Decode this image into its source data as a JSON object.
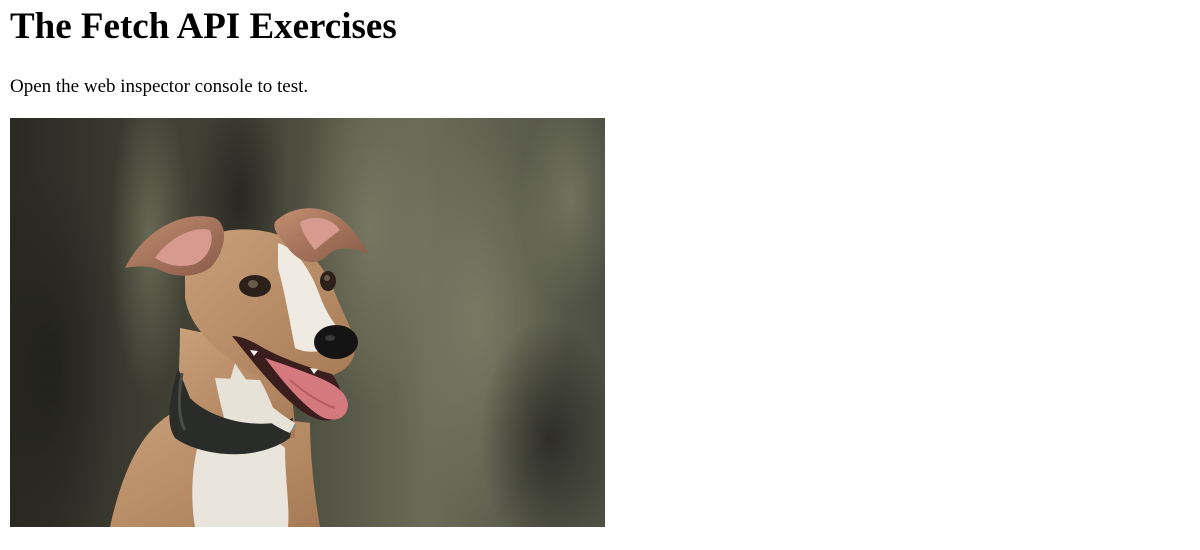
{
  "page": {
    "heading": "The Fetch API Exercises",
    "instruction": "Open the web inspector console to test."
  },
  "image": {
    "subject": "whippet-dog-photo"
  }
}
